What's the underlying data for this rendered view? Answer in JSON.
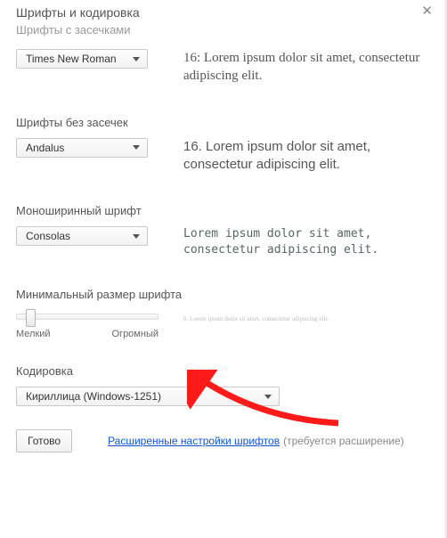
{
  "header": {
    "title": "Шрифты и кодировка",
    "subtitle": "Шрифты с засечками"
  },
  "sections": {
    "serif": {
      "select": "Times New Roman",
      "preview": "16: Lorem ipsum dolor sit amet, consectetur adipiscing elit."
    },
    "sans": {
      "label": "Шрифты без засечек",
      "select": "Andalus",
      "preview": "16. Lorem ipsum dolor sit amet, consectetur adipiscing elit."
    },
    "mono": {
      "label": "Моноширинный шрифт",
      "select": "Consolas",
      "preview": "Lorem ipsum dolor sit amet, consectetur adipiscing elit."
    },
    "minsize": {
      "label": "Минимальный размер шрифта",
      "preview": "6. Lorem ipsum dolor sit amet, consectetur adipiscing elit.",
      "track_min": "Мелкий",
      "track_max": "Огромный"
    },
    "encoding": {
      "label": "Кодировка",
      "select": "Кириллица (Windows-1251)"
    }
  },
  "footer": {
    "done": "Готово",
    "link": "Расширенные настройки шрифтов",
    "hint": "(требуется расширение)"
  }
}
